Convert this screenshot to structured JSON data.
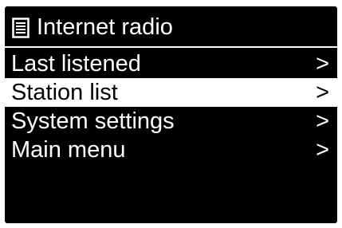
{
  "header": {
    "title": "Internet radio",
    "icon": "list-document-icon"
  },
  "menu": {
    "items": [
      {
        "label": "Last listened",
        "arrow": ">",
        "selected": false
      },
      {
        "label": "Station list",
        "arrow": ">",
        "selected": true
      },
      {
        "label": "System settings",
        "arrow": ">",
        "selected": false
      },
      {
        "label": "Main menu",
        "arrow": ">",
        "selected": false
      }
    ]
  },
  "colors": {
    "background": "#000000",
    "foreground": "#ffffff",
    "highlight": "#ffffff",
    "highlight_text": "#000000"
  }
}
